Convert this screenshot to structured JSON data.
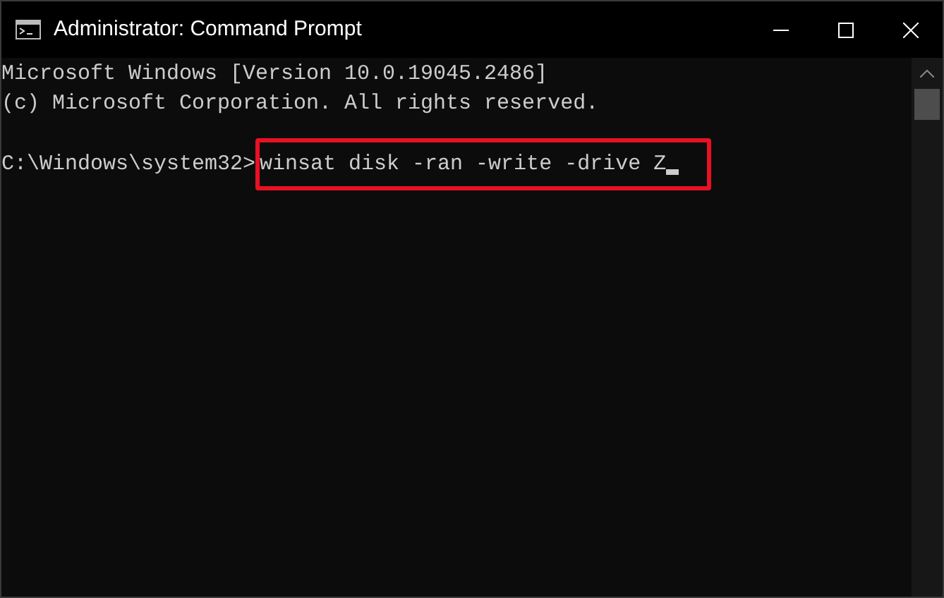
{
  "window": {
    "title": "Administrator: Command Prompt"
  },
  "console": {
    "lines": [
      "Microsoft Windows [Version 10.0.19045.2486]",
      "(c) Microsoft Corporation. All rights reserved."
    ],
    "prompt": "C:\\Windows\\system32>",
    "command": "winsat disk -ran -write -drive Z",
    "command_highlighted": true,
    "cursor": true
  }
}
